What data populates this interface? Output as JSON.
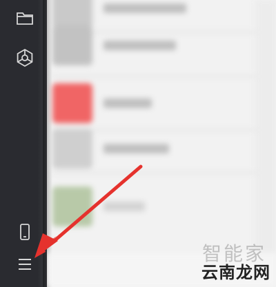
{
  "sidebar": {
    "icons": [
      {
        "name": "folder-icon"
      },
      {
        "name": "settings-gear-icon"
      },
      {
        "name": "phone-icon"
      },
      {
        "name": "menu-hamburger-icon"
      }
    ]
  },
  "watermark": {
    "main_text": "云南龙网",
    "faded_text": "智能家"
  },
  "colors": {
    "sidebar_bg": "#2a2b30",
    "arrow": "#e5322d",
    "highlight_thumb": "#f06565"
  }
}
